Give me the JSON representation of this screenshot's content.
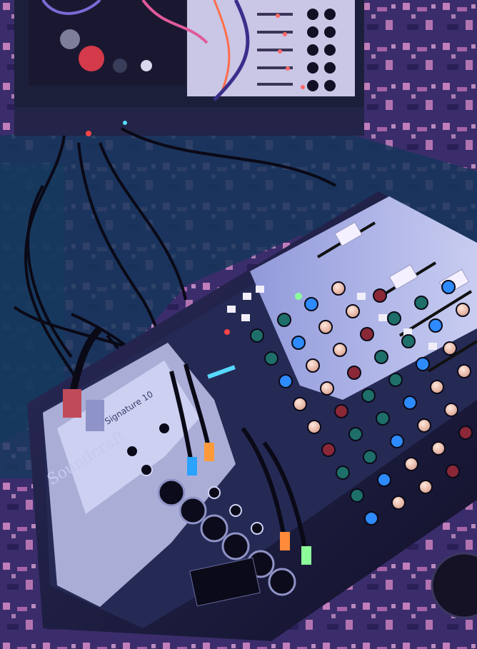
{
  "photo": {
    "subject": "",
    "mixer": {
      "brand_text": "Soundcraft",
      "model_text": "Signature 10",
      "channel_strips": 6,
      "faders": 3
    },
    "colors": {
      "rug_pink": "#d98cc8",
      "rug_dark": "#2a1f56",
      "mixer_body": "#1b1a3a",
      "panel_light": "#cfd3f5",
      "knob_cream": "#f3c9b8",
      "knob_teal": "#1e6f6a",
      "knob_blue": "#2d8bff",
      "knob_red": "#8a2838",
      "led_red": "#ff4545",
      "led_green": "#8aff9c"
    }
  }
}
